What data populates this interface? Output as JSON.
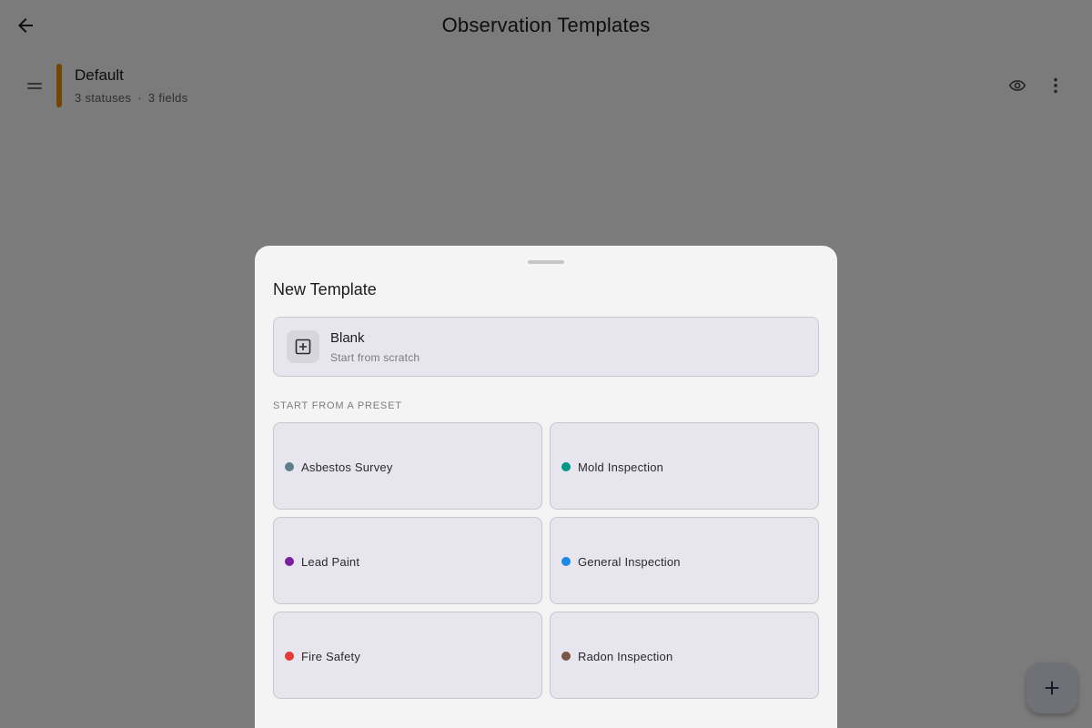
{
  "header": {
    "title": "Observation Templates"
  },
  "templates": [
    {
      "name": "Default",
      "statuses": "3 statuses",
      "separator": "·",
      "fields": "3 fields",
      "color": "#e68a00"
    }
  ],
  "sheet": {
    "title": "New Template",
    "blank": {
      "title": "Blank",
      "subtitle": "Start from scratch",
      "icon": "plus-square-icon"
    },
    "section_label": "START FROM A PRESET",
    "presets": [
      {
        "label": "Asbestos Survey",
        "color": "#607d8b"
      },
      {
        "label": "Mold Inspection",
        "color": "#009688"
      },
      {
        "label": "Lead Paint",
        "color": "#7b1fa2"
      },
      {
        "label": "General Inspection",
        "color": "#1e88e5"
      },
      {
        "label": "Fire Safety",
        "color": "#e53935"
      },
      {
        "label": "Radon Inspection",
        "color": "#795548"
      }
    ]
  },
  "icons": {
    "back": "arrow-left-icon",
    "drag": "drag-handle-icon",
    "preview": "eye-icon",
    "more": "more-vertical-icon",
    "add": "plus-icon"
  }
}
